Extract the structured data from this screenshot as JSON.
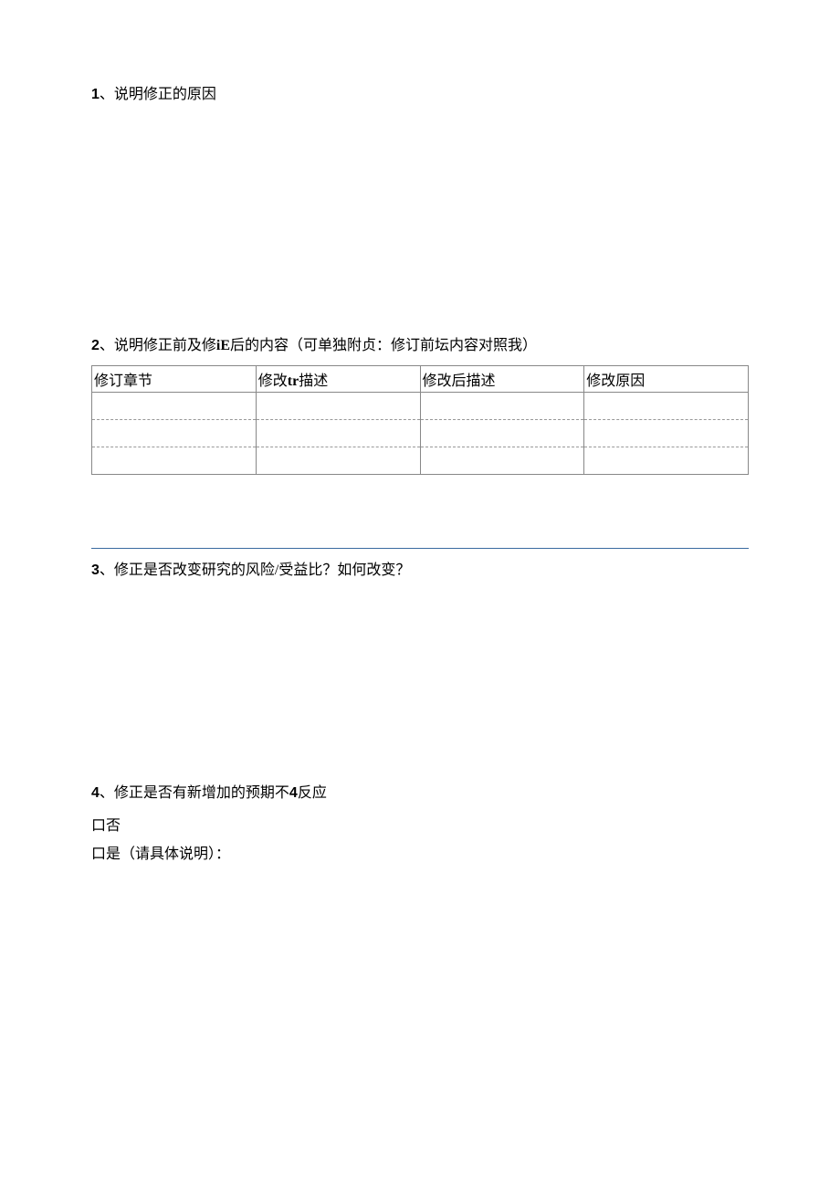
{
  "section1": {
    "num": "1",
    "text": "、说明修正的原因"
  },
  "section2": {
    "num": "2",
    "text_a": "、说明修正前及修",
    "bold": "iE",
    "text_b": "后的内容（可单独附贞：修订前坛内容对照我）",
    "table": {
      "headers": {
        "c1": "修订章节",
        "c2_a": "修改",
        "c2_bold": "tr",
        "c2_b": "描述",
        "c3": "修改后描述",
        "c4": "修改原因"
      },
      "rows": [
        {
          "c1": "",
          "c2": "",
          "c3": "",
          "c4": ""
        },
        {
          "c1": "",
          "c2": "",
          "c3": "",
          "c4": ""
        },
        {
          "c1": "",
          "c2": "",
          "c3": "",
          "c4": ""
        }
      ]
    }
  },
  "section3": {
    "num": "3",
    "text": "、修正是否改变研究的风险/受益比？如何改变？"
  },
  "section4": {
    "num": "4",
    "text_a": "、修正是否有新增加的预期不",
    "bold": "4",
    "text_b": "反应",
    "opt_no": "口否",
    "opt_yes": "口是（请具体说明）："
  }
}
